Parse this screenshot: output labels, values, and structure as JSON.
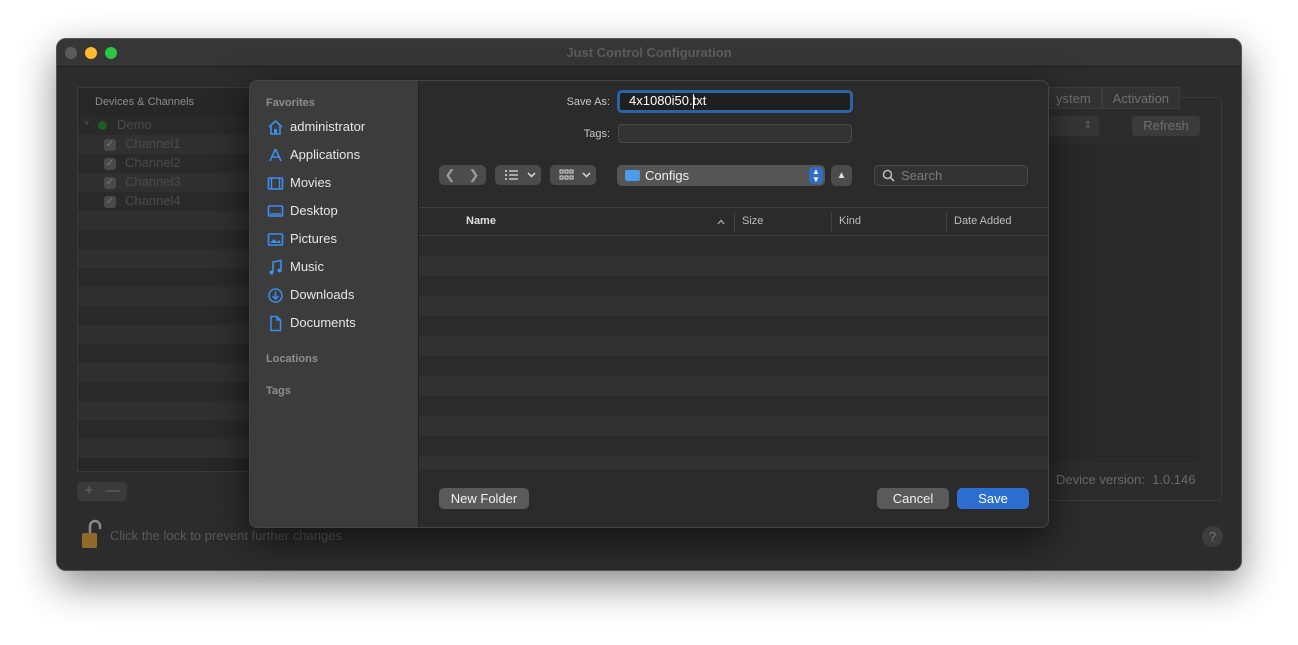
{
  "window": {
    "title": "Just Control Configuration"
  },
  "devices": {
    "header": "Devices & Channels",
    "root": "Demo",
    "channels": [
      "Channel1",
      "Channel2",
      "Channel3",
      "Channel4"
    ],
    "plus": "+",
    "minus": "—"
  },
  "right": {
    "tabs": [
      "ystem",
      "Activation"
    ],
    "refresh": "Refresh",
    "device_version_label": "Device version:",
    "device_version": "1.0.146"
  },
  "lock_text": "Click the lock to prevent further changes",
  "help": "?",
  "dialog": {
    "sidebar": {
      "favorites_label": "Favorites",
      "items": [
        {
          "label": "administrator",
          "icon": "home-icon"
        },
        {
          "label": "Applications",
          "icon": "applications-icon"
        },
        {
          "label": "Movies",
          "icon": "film-icon"
        },
        {
          "label": "Desktop",
          "icon": "desktop-icon"
        },
        {
          "label": "Pictures",
          "icon": "photo-icon"
        },
        {
          "label": "Music",
          "icon": "music-note-icon"
        },
        {
          "label": "Downloads",
          "icon": "download-icon"
        },
        {
          "label": "Documents",
          "icon": "document-icon"
        }
      ],
      "locations_label": "Locations",
      "tags_label": "Tags"
    },
    "save_as_label": "Save As:",
    "save_as_value": "4x1080i50.txt",
    "tags_label": "Tags:",
    "folder": "Configs",
    "search_placeholder": "Search",
    "columns": {
      "name": "Name",
      "size": "Size",
      "kind": "Kind",
      "date_added": "Date Added"
    },
    "new_folder": "New Folder",
    "cancel": "Cancel",
    "save": "Save"
  },
  "colors": {
    "accent": "#2d6fd1",
    "sidebar_icon": "#3b8ff0"
  }
}
